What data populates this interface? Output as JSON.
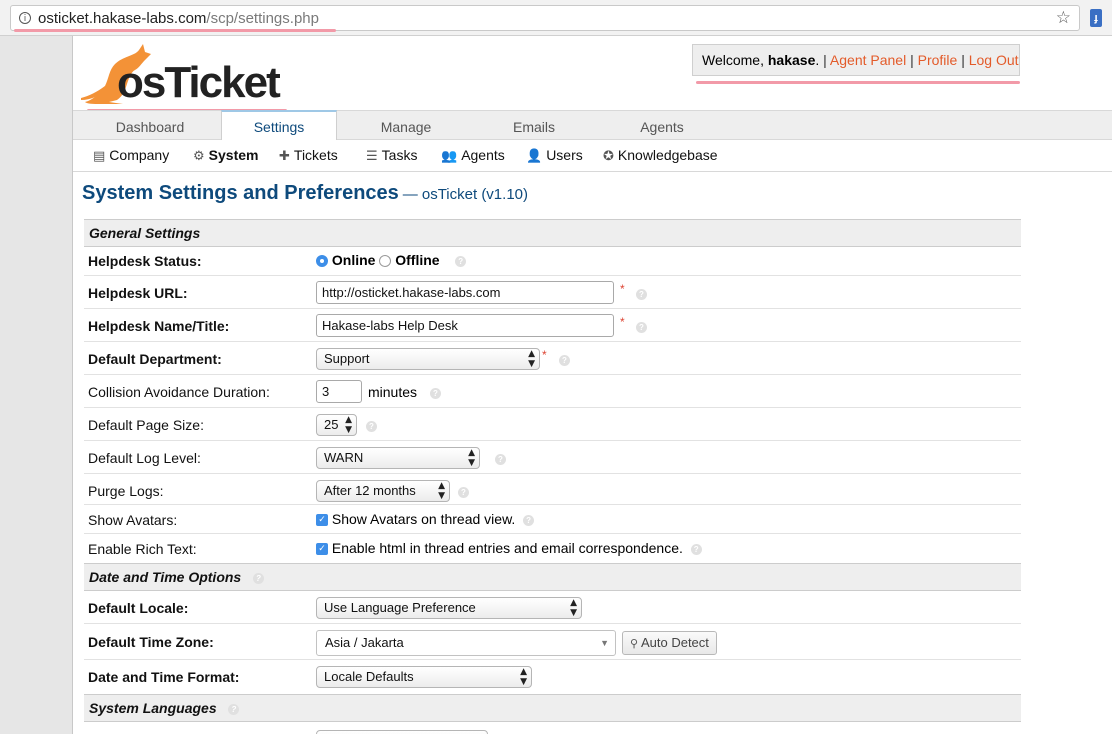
{
  "browser": {
    "url_host": "osticket.hakase-labs.com",
    "url_path": "/scp/settings.php"
  },
  "logo": {
    "text": "osTicket"
  },
  "header": {
    "welcome_prefix": "Welcome, ",
    "username": "hakase",
    "welcome_suffix": ".",
    "sep": "|",
    "agent_panel": "Agent Panel",
    "profile": "Profile",
    "logout": "Log Out"
  },
  "tabs": [
    {
      "label": "Dashboard"
    },
    {
      "label": "Settings"
    },
    {
      "label": "Manage"
    },
    {
      "label": "Emails"
    },
    {
      "label": "Agents"
    }
  ],
  "subnav": [
    {
      "label": "Company"
    },
    {
      "label": "System"
    },
    {
      "label": "Tickets"
    },
    {
      "label": "Tasks"
    },
    {
      "label": "Agents"
    },
    {
      "label": "Users"
    },
    {
      "label": "Knowledgebase"
    }
  ],
  "page": {
    "title": "System Settings and Preferences",
    "subtitle": "— osTicket (v1.10)"
  },
  "sections": {
    "general": "General Settings",
    "datetime": "Date and Time Options",
    "languages": "System Languages"
  },
  "fields": {
    "helpdesk_status": {
      "label": "Helpdesk Status:",
      "online": "Online",
      "offline": "Offline"
    },
    "helpdesk_url": {
      "label": "Helpdesk URL:",
      "value": "http://osticket.hakase-labs.com"
    },
    "helpdesk_name": {
      "label": "Helpdesk Name/Title:",
      "value": "Hakase-labs Help Desk"
    },
    "default_department": {
      "label": "Default Department:",
      "value": "Support"
    },
    "collision": {
      "label": "Collision Avoidance Duration:",
      "value": "3",
      "unit": "minutes"
    },
    "page_size": {
      "label": "Default Page Size:",
      "value": "25"
    },
    "log_level": {
      "label": "Default Log Level:",
      "value": "WARN"
    },
    "purge_logs": {
      "label": "Purge Logs:",
      "value": "After 12 months"
    },
    "show_avatars": {
      "label": "Show Avatars:",
      "text": "Show Avatars on thread view."
    },
    "rich_text": {
      "label": "Enable Rich Text:",
      "text": "Enable html in thread entries and email correspondence."
    },
    "default_locale": {
      "label": "Default Locale:",
      "value": "Use Language Preference"
    },
    "time_zone": {
      "label": "Default Time Zone:",
      "value": "Asia / Jakarta",
      "button": "Auto Detect"
    },
    "date_format": {
      "label": "Date and Time Format:",
      "value": "Locale Defaults"
    }
  },
  "symbols": {
    "required": "*",
    "help": "?"
  }
}
